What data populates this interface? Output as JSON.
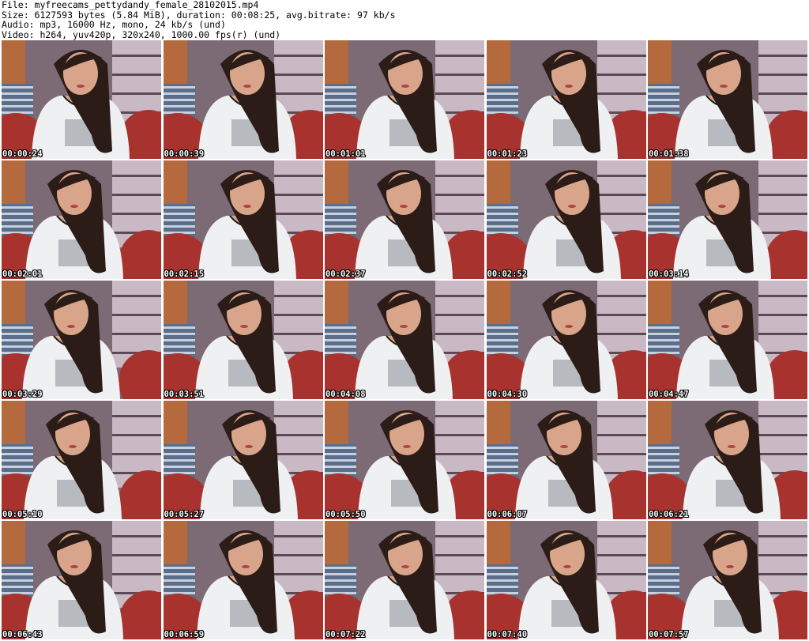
{
  "header": {
    "file_line": "File: myfreecams_pettydandy_female_28102015.mp4",
    "size_line": "Size: 6127593 bytes (5.84 MiB), duration: 00:08:25, avg.bitrate: 97 kb/s",
    "audio_line": "Audio: mp3, 16000 Hz, mono, 24 kb/s (und)",
    "video_line": "Video: h264, yuv420p, 320x240, 1000.00 fps(r) (und)"
  },
  "thumbnails": [
    {
      "timestamp": "00:00:24"
    },
    {
      "timestamp": "00:00:39"
    },
    {
      "timestamp": "00:01:01"
    },
    {
      "timestamp": "00:01:23"
    },
    {
      "timestamp": "00:01:38"
    },
    {
      "timestamp": "00:02:01"
    },
    {
      "timestamp": "00:02:15"
    },
    {
      "timestamp": "00:02:37"
    },
    {
      "timestamp": "00:02:52"
    },
    {
      "timestamp": "00:03:14"
    },
    {
      "timestamp": "00:03:29"
    },
    {
      "timestamp": "00:03:51"
    },
    {
      "timestamp": "00:04:08"
    },
    {
      "timestamp": "00:04:30"
    },
    {
      "timestamp": "00:04:47"
    },
    {
      "timestamp": "00:05:10"
    },
    {
      "timestamp": "00:05:27"
    },
    {
      "timestamp": "00:05:50"
    },
    {
      "timestamp": "00:06:07"
    },
    {
      "timestamp": "00:06:21"
    },
    {
      "timestamp": "00:06:43"
    },
    {
      "timestamp": "00:06:59"
    },
    {
      "timestamp": "00:07:22"
    },
    {
      "timestamp": "00:07:40"
    },
    {
      "timestamp": "00:07:57"
    }
  ],
  "colors": {
    "background": "#ffffff",
    "wall": "#7c6a75",
    "shelf": "#c9b9c4",
    "sofa": "#a8332e",
    "shirt": "#eef0f2",
    "skin": "#d9a58a",
    "hair": "#2b1c17",
    "blanket": "#5a6e8c"
  }
}
